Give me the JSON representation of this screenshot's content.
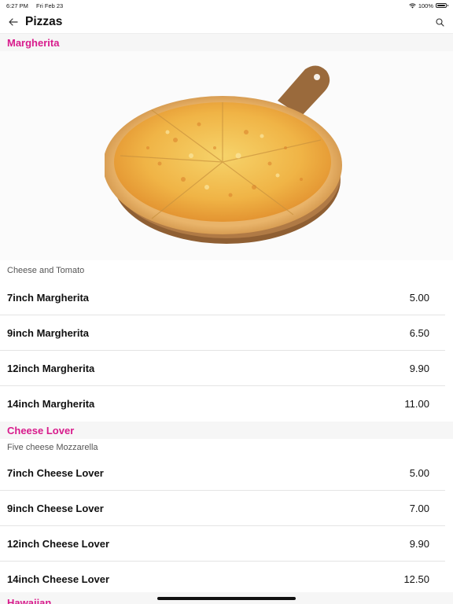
{
  "status_bar": {
    "time": "6:27 PM",
    "date": "Fri Feb 23",
    "battery": "100%"
  },
  "header": {
    "title": "Pizzas"
  },
  "sections": [
    {
      "name": "Margherita",
      "description": "Cheese and Tomato",
      "items": [
        {
          "name": "7inch Margherita",
          "price": "5.00"
        },
        {
          "name": "9inch Margherita",
          "price": "6.50"
        },
        {
          "name": "12inch Margherita",
          "price": "9.90"
        },
        {
          "name": "14inch Margherita",
          "price": "11.00"
        }
      ]
    },
    {
      "name": "Cheese Lover",
      "description": "Five cheese Mozzarella",
      "items": [
        {
          "name": "7inch Cheese Lover",
          "price": "5.00"
        },
        {
          "name": "9inch Cheese Lover",
          "price": "7.00"
        },
        {
          "name": "12inch Cheese Lover",
          "price": "9.90"
        },
        {
          "name": "14inch Cheese Lover",
          "price": "12.50"
        }
      ]
    },
    {
      "name": "Hawaiian"
    }
  ],
  "colors": {
    "accent": "#d81b8c",
    "section_bg": "#f6f6f6"
  },
  "icons": {
    "back": "arrow-left-icon",
    "search": "search-icon"
  }
}
